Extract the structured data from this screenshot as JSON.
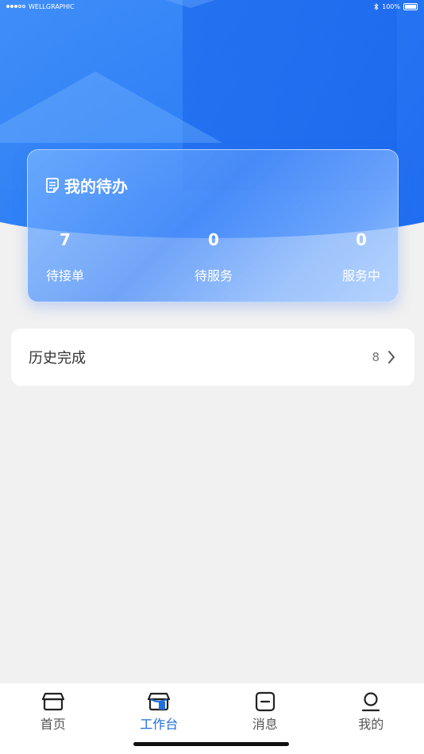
{
  "status_bar": {
    "carrier": "WELLGRAPHIC",
    "battery": "100%"
  },
  "todo": {
    "title": "我的待办",
    "stats": [
      {
        "value": "7",
        "label": "待接单"
      },
      {
        "value": "0",
        "label": "待服务"
      },
      {
        "value": "0",
        "label": "服务中"
      }
    ]
  },
  "history": {
    "label": "历史完成",
    "count": "8"
  },
  "tabbar": {
    "items": [
      {
        "label": "首页",
        "icon": "home-store-icon"
      },
      {
        "label": "工作台",
        "icon": "workbench-store-icon"
      },
      {
        "label": "消息",
        "icon": "message-icon"
      },
      {
        "label": "我的",
        "icon": "profile-icon"
      }
    ],
    "active_index": 1
  },
  "colors": {
    "accent": "#1f6fe0",
    "hero_blue": "#2a7cf5",
    "background": "#f1f1f1"
  }
}
